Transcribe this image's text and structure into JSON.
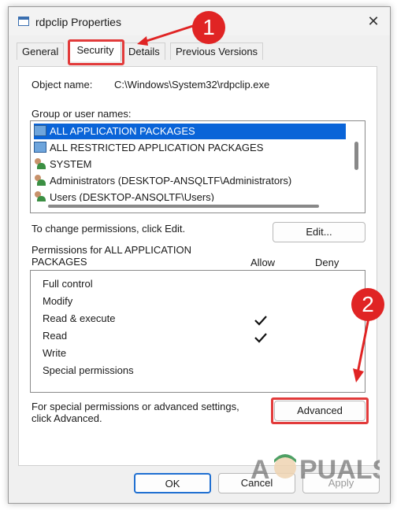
{
  "window": {
    "title": "rdpclip Properties"
  },
  "tabs": [
    {
      "label": "General"
    },
    {
      "label": "Security"
    },
    {
      "label": "Details"
    },
    {
      "label": "Previous Versions"
    }
  ],
  "security": {
    "object_name_label": "Object name:",
    "object_name_value": "C:\\Windows\\System32\\rdpclip.exe",
    "group_label": "Group or user names:",
    "groups": [
      {
        "name": "ALL APPLICATION PACKAGES",
        "icon": "package-icon"
      },
      {
        "name": "ALL RESTRICTED APPLICATION PACKAGES",
        "icon": "package-icon"
      },
      {
        "name": "SYSTEM",
        "icon": "users-icon"
      },
      {
        "name": "Administrators (DESKTOP-ANSQLTF\\Administrators)",
        "icon": "users-icon"
      },
      {
        "name": "Users (DESKTOP-ANSQLTF\\Users)",
        "icon": "users-icon"
      }
    ],
    "change_text": "To change permissions, click Edit.",
    "edit_label": "Edit...",
    "permissions_for_line1": "Permissions for ALL APPLICATION",
    "permissions_for_line2": "PACKAGES",
    "allow_label": "Allow",
    "deny_label": "Deny",
    "permissions": [
      {
        "name": "Full control",
        "allow": false
      },
      {
        "name": "Modify",
        "allow": false
      },
      {
        "name": "Read & execute",
        "allow": true
      },
      {
        "name": "Read",
        "allow": true
      },
      {
        "name": "Write",
        "allow": false
      },
      {
        "name": "Special permissions",
        "allow": false
      }
    ],
    "special_text_line1": "For special permissions or advanced settings,",
    "special_text_line2": "click Advanced.",
    "advanced_label": "Advanced"
  },
  "footer": {
    "ok": "OK",
    "cancel": "Cancel",
    "apply": "Apply"
  },
  "annotations": {
    "step1": "1",
    "step2": "2",
    "color": "#e02424"
  },
  "watermark": "APPUALS"
}
